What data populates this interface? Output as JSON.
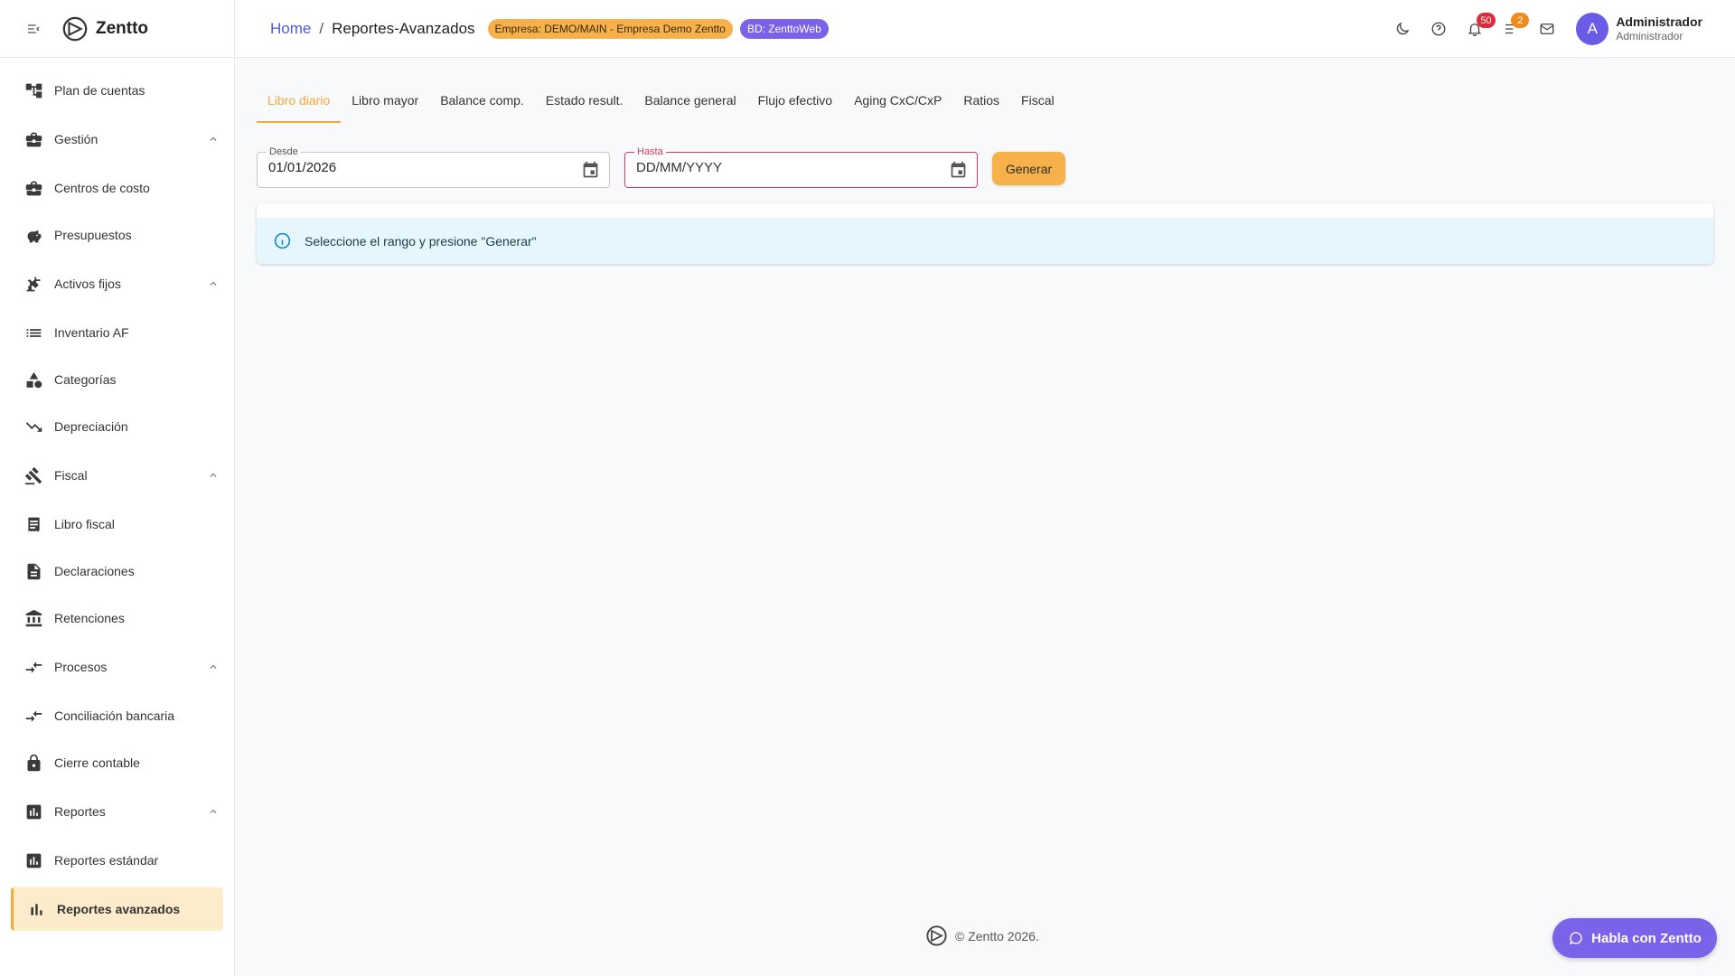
{
  "app": {
    "name": "Zentto"
  },
  "sidebar": {
    "items": [
      {
        "label": "Plan de cuentas",
        "icon": "account-tree-icon"
      },
      {
        "label": "Gestión",
        "icon": "briefcase-icon",
        "expanded": true
      },
      {
        "label": "Centros de costo",
        "icon": "briefcase-icon"
      },
      {
        "label": "Presupuestos",
        "icon": "savings-icon"
      },
      {
        "label": "Activos fijos",
        "icon": "precision-tool-icon",
        "expanded": true
      },
      {
        "label": "Inventario AF",
        "icon": "list-icon"
      },
      {
        "label": "Categorías",
        "icon": "category-icon"
      },
      {
        "label": "Depreciación",
        "icon": "trending-down-icon"
      },
      {
        "label": "Fiscal",
        "icon": "gavel-icon",
        "expanded": true
      },
      {
        "label": "Libro fiscal",
        "icon": "receipt-icon"
      },
      {
        "label": "Declaraciones",
        "icon": "description-icon"
      },
      {
        "label": "Retenciones",
        "icon": "bank-icon"
      },
      {
        "label": "Procesos",
        "icon": "compare-arrows-icon",
        "expanded": true
      },
      {
        "label": "Conciliación bancaria",
        "icon": "compare-arrows-icon"
      },
      {
        "label": "Cierre contable",
        "icon": "lock-icon"
      },
      {
        "label": "Reportes",
        "icon": "bar-chart-icon",
        "expanded": true
      },
      {
        "label": "Reportes estándar",
        "icon": "bar-chart-icon"
      },
      {
        "label": "Reportes avanzados",
        "icon": "bar-chart-icon",
        "active": true
      }
    ]
  },
  "header": {
    "breadcrumb_home": "Home",
    "breadcrumb_sep": "/",
    "breadcrumb_current": "Reportes-Avanzados",
    "empresa_badge": "Empresa: DEMO/MAIN - Empresa Demo Zentto",
    "bd_badge": "BD: ZenttoWeb",
    "notifications_count": "50",
    "tasks_count": "2",
    "avatar_initial": "A",
    "user_name": "Administrador",
    "user_role": "Administrador"
  },
  "tabs": [
    {
      "label": "Libro diario",
      "active": true
    },
    {
      "label": "Libro mayor"
    },
    {
      "label": "Balance comp."
    },
    {
      "label": "Estado result."
    },
    {
      "label": "Balance general"
    },
    {
      "label": "Flujo efectivo"
    },
    {
      "label": "Aging CxC/CxP"
    },
    {
      "label": "Ratios"
    },
    {
      "label": "Fiscal"
    }
  ],
  "form": {
    "desde_label": "Desde",
    "desde_value": "01/01/2026",
    "hasta_label": "Hasta",
    "hasta_placeholder": "DD/MM/YYYY",
    "generar_label": "Generar"
  },
  "alert": {
    "message": "Seleccione el rango y presione \"Generar\""
  },
  "footer": {
    "text": "© Zentto 2026."
  },
  "chat": {
    "label": "Habla con Zentto"
  },
  "colors": {
    "accent": "#f3a93c",
    "primary": "#7a63e8",
    "link": "#4b5bd6",
    "error": "#d33a64",
    "info_bg": "#e6f6fd"
  }
}
